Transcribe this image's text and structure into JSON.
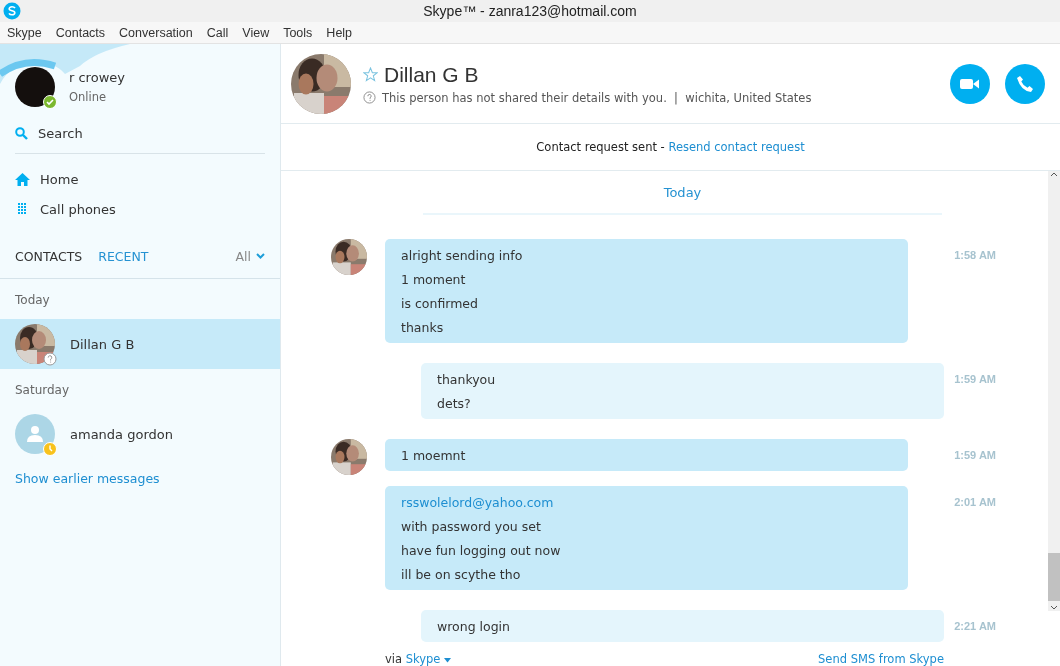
{
  "window": {
    "title": "Skype™ - zanra123@hotmail.com"
  },
  "menu": [
    "Skype",
    "Contacts",
    "Conversation",
    "Call",
    "View",
    "Tools",
    "Help"
  ],
  "profile": {
    "name": "r crowey",
    "status_text": "Online",
    "online": true
  },
  "search": {
    "label": "Search"
  },
  "nav": [
    {
      "label": "Home",
      "kind": "home"
    },
    {
      "label": "Call phones",
      "kind": "dialpad"
    }
  ],
  "list_tabs": [
    {
      "label": "CONTACTS",
      "selected": false
    },
    {
      "label": "RECENT",
      "selected": true
    }
  ],
  "filter": {
    "label": "All"
  },
  "recent": [
    {
      "heading": "Today",
      "contacts": [
        {
          "name": "Dillan G B",
          "kind": "unknown",
          "has_photo": true,
          "selected": true
        }
      ]
    },
    {
      "heading": "Saturday",
      "contacts": [
        {
          "name": "amanda gordon",
          "kind": "pending",
          "has_photo": false,
          "selected": false
        }
      ]
    }
  ],
  "show_earlier": "Show earlier messages",
  "contact": {
    "name": "Dillan G B",
    "details": "This person has not shared their details with you.  |  wichita, United States"
  },
  "request_bar": {
    "text": "Contact request sent - ",
    "link": "Resend contact request"
  },
  "day_label": "Today",
  "messages": [
    {
      "kind": "incoming",
      "avatar": true,
      "time": "1:58 AM",
      "lines": [
        {
          "text": "alright sending info",
          "link": false
        },
        {
          "text": "1 moment",
          "link": false
        },
        {
          "text": "is confirmed",
          "link": false
        },
        {
          "text": "thanks",
          "link": false
        }
      ]
    },
    {
      "kind": "outgoing",
      "avatar": false,
      "time": "1:59 AM",
      "lines": [
        {
          "text": "thankyou",
          "link": false
        },
        {
          "text": "dets?",
          "link": false
        }
      ]
    },
    {
      "kind": "incoming",
      "avatar": true,
      "time": "1:59 AM",
      "lines": [
        {
          "text": "1 moemnt",
          "link": false
        }
      ]
    },
    {
      "kind": "incoming",
      "avatar": false,
      "time": "2:01 AM",
      "lines": [
        {
          "text": "rsswolelord@yahoo.com",
          "link": true
        },
        {
          "text": "with password you set",
          "link": false
        },
        {
          "text": "have fun logging out now",
          "link": false
        },
        {
          "text": "ill be on scythe tho",
          "link": false
        }
      ]
    },
    {
      "kind": "outgoing",
      "avatar": false,
      "time": "2:21 AM",
      "lines": [
        {
          "text": "wrong login",
          "link": false
        }
      ]
    }
  ],
  "footer": {
    "via": "via",
    "service": "Skype",
    "sms": "Send SMS from Skype"
  }
}
